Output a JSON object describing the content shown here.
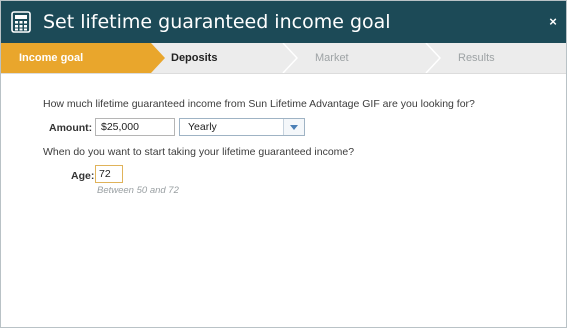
{
  "window": {
    "title": "Set lifetime guaranteed income goal",
    "close_label": "×",
    "icon": "calculator-icon"
  },
  "steps": [
    {
      "label": "Income goal",
      "state": "active"
    },
    {
      "label": "Deposits",
      "state": "next"
    },
    {
      "label": "Market",
      "state": "disabled"
    },
    {
      "label": "Results",
      "state": "disabled"
    }
  ],
  "form": {
    "question_amount": "How much lifetime guaranteed income from Sun Lifetime Advantage GIF are you looking for?",
    "amount_label": "Amount:",
    "amount_value": "$25,000",
    "frequency_value": "Yearly",
    "question_age": "When do you want to start taking your lifetime guaranteed income?",
    "age_label": "Age:",
    "age_value": "72",
    "age_hint": "Between 50 and 72"
  },
  "colors": {
    "titlebar": "#1c4a57",
    "active_step": "#e9a62c",
    "step_bar": "#ececec"
  }
}
